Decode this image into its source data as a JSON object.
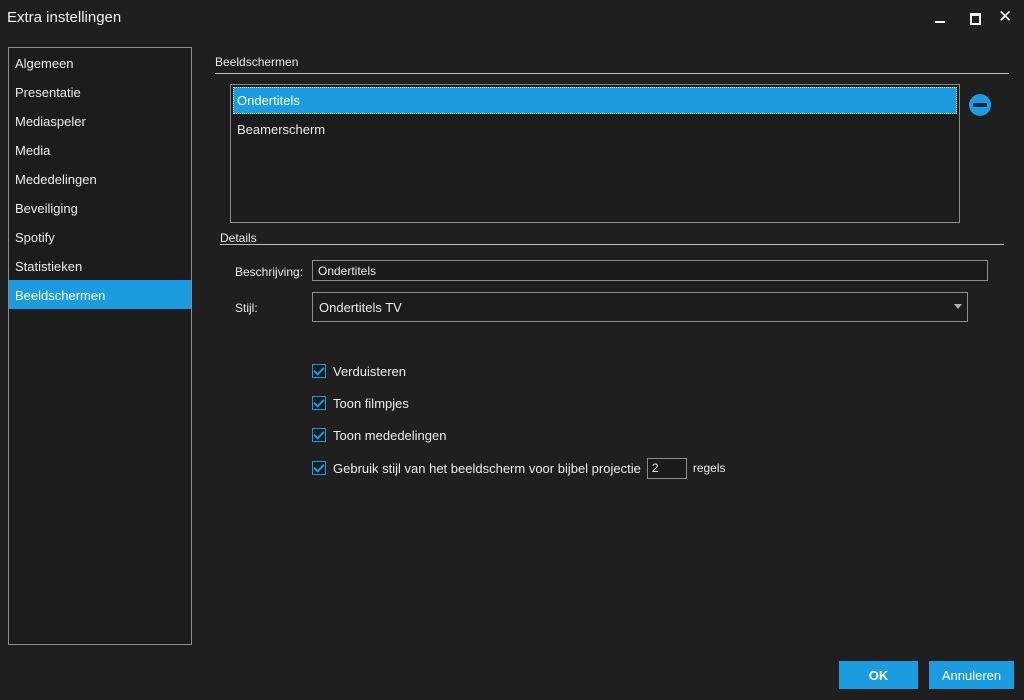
{
  "window": {
    "title": "Extra instellingen"
  },
  "sidebar": {
    "items": [
      {
        "label": "Algemeen",
        "active": false
      },
      {
        "label": "Presentatie",
        "active": false
      },
      {
        "label": "Mediaspeler",
        "active": false
      },
      {
        "label": "Media",
        "active": false
      },
      {
        "label": "Mededelingen",
        "active": false
      },
      {
        "label": "Beveiliging",
        "active": false
      },
      {
        "label": "Spotify",
        "active": false
      },
      {
        "label": "Statistieken",
        "active": false
      },
      {
        "label": "Beeldschermen",
        "active": true
      }
    ]
  },
  "main": {
    "section_title": "Beeldschermen",
    "screens": [
      {
        "label": "Ondertitels",
        "selected": true
      },
      {
        "label": "Beamerscherm",
        "selected": false
      }
    ],
    "details": {
      "section_title": "Details",
      "description_label": "Beschrijving:",
      "description_value": "Ondertitels",
      "style_label": "Stijl:",
      "style_value": "Ondertitels TV",
      "options": [
        {
          "label": "Verduisteren",
          "checked": true
        },
        {
          "label": "Toon filmpjes",
          "checked": true
        },
        {
          "label": "Toon mededelingen",
          "checked": true
        },
        {
          "label": "Gebruik stijl van het beeldscherm voor bijbel projectie",
          "checked": true
        }
      ],
      "lines_value": "2",
      "lines_suffix": "regels"
    }
  },
  "footer": {
    "ok_label": "OK",
    "cancel_label": "Annuleren"
  },
  "colors": {
    "accent": "#1b9ce0",
    "background": "#1f1f1f",
    "border": "#8c8c8c"
  }
}
